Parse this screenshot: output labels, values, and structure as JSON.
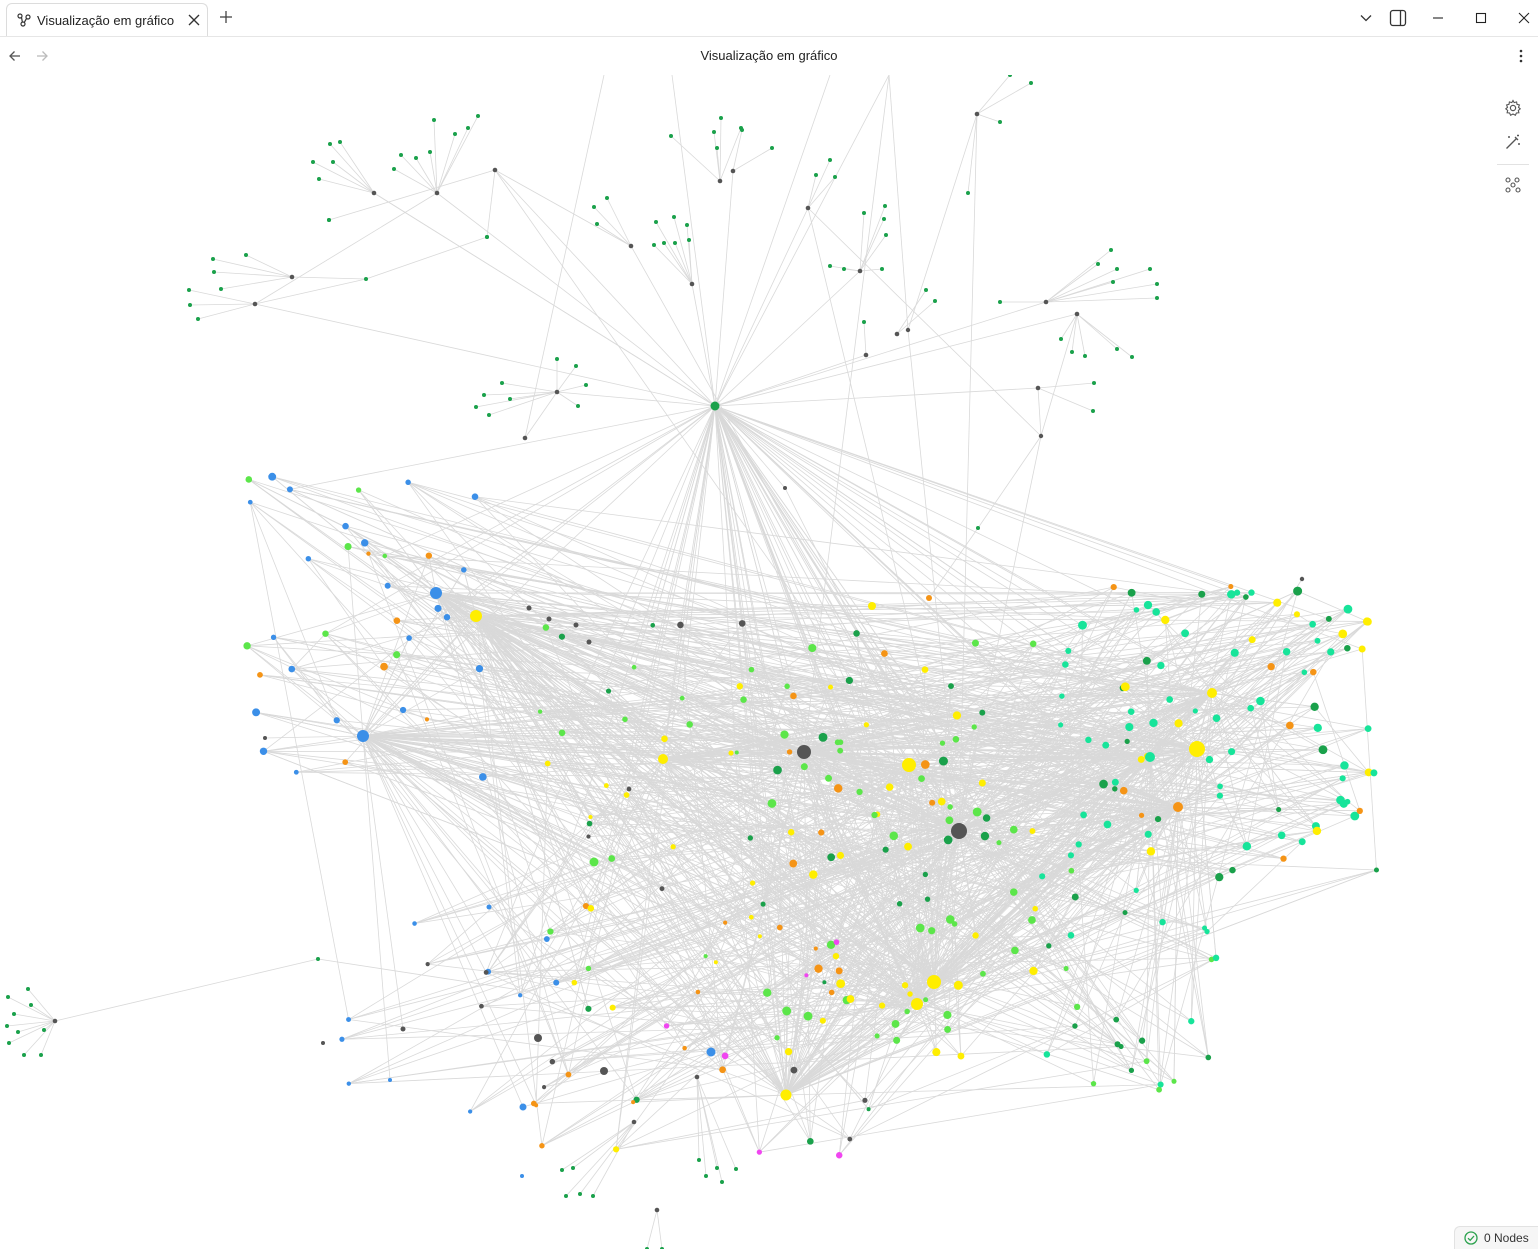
{
  "tab": {
    "title": "Visualização em gráfico",
    "icon": "graph-icon",
    "close_icon": "close-icon",
    "new_tab_icon": "plus-icon"
  },
  "window_controls": [
    "chevron-down-icon",
    "sidebar-toggle-icon",
    "minimize-icon",
    "maximize-icon",
    "close-icon"
  ],
  "view": {
    "title": "Visualização em gráfico",
    "back_icon": "arrow-left-icon",
    "forward_icon": "arrow-right-icon",
    "more_icon": "more-vertical-icon"
  },
  "graph_controls": [
    "settings-gear-icon",
    "magic-wand-icon",
    "graph-layout-icon"
  ],
  "status": {
    "text": "0 Nodes",
    "icon": "check-circle-icon"
  },
  "colors": {
    "edge": "#d9d9d9",
    "hub_gray": "#555555",
    "dark_green": "#1aa14b",
    "light_green": "#5ce64a",
    "mint": "#17e49a",
    "yellow": "#ffee00",
    "orange": "#f59416",
    "blue": "#3b8fe8",
    "magenta": "#f046f0",
    "status_check": "#2ca24e"
  }
}
